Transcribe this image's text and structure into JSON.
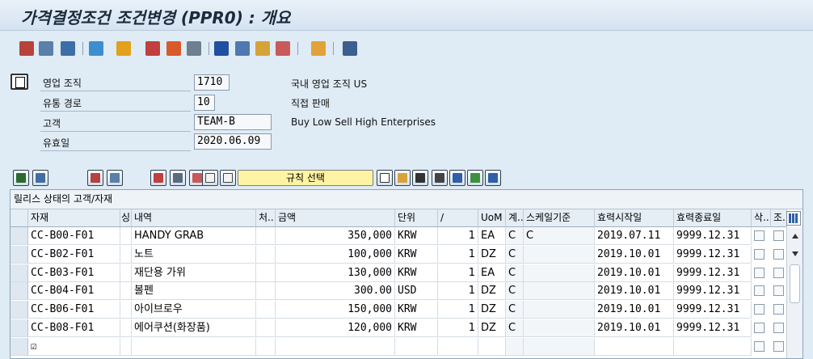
{
  "window": {
    "title": "가격결정조건 조건변경 (PPR0) : 개요"
  },
  "app_toolbar": {
    "icons": [
      "other-condition-type-icon",
      "display-icon",
      "variable-key-icon",
      "copy-icon",
      "execute-icon",
      "validity-periods-icon",
      "free-goods-icon",
      "change-icon",
      "info-icon",
      "details-icon",
      "key-icon",
      "scales-icon",
      "user-icon",
      "extras-icon"
    ]
  },
  "header": {
    "fields": [
      {
        "label": "영업 조직",
        "value": "1710",
        "desc": "국내 영업 조직 US"
      },
      {
        "label": "유통 경로",
        "value": "10",
        "desc": "직접 판매"
      },
      {
        "label": "고객",
        "value": "TEAM-B",
        "desc": "Buy Low Sell High Enterprises"
      },
      {
        "label": "유효일",
        "value": "2020.06.09",
        "desc": ""
      }
    ]
  },
  "grid_toolbar": {
    "rule_button": "규칙 선택"
  },
  "grid": {
    "title": "릴리스 상태의 고객/자재",
    "columns": [
      "자재",
      "싱",
      "내역",
      "처..",
      "금액",
      "단위",
      "/",
      "UoM",
      "계..",
      "스케일기준",
      "효력시작일",
      "효력종료일",
      "삭..",
      "조.."
    ],
    "rows": [
      {
        "material": "CC-B00-F01",
        "desc": "HANDY GRAB",
        "amount": "350,000",
        "unit": "KRW",
        "per": "1",
        "uom": "EA",
        "calc": "C",
        "scale": "C",
        "from": "2019.07.11",
        "to": "9999.12.31"
      },
      {
        "material": "CC-B02-F01",
        "desc": "노트",
        "amount": "100,000",
        "unit": "KRW",
        "per": "1",
        "uom": "DZ",
        "calc": "C",
        "scale": "",
        "from": "2019.10.01",
        "to": "9999.12.31"
      },
      {
        "material": "CC-B03-F01",
        "desc": "재단용 가위",
        "amount": "130,000",
        "unit": "KRW",
        "per": "1",
        "uom": "EA",
        "calc": "C",
        "scale": "",
        "from": "2019.10.01",
        "to": "9999.12.31"
      },
      {
        "material": "CC-B04-F01",
        "desc": "볼펜",
        "amount": "300.00",
        "unit": "USD",
        "per": "1",
        "uom": "DZ",
        "calc": "C",
        "scale": "",
        "from": "2019.10.01",
        "to": "9999.12.31"
      },
      {
        "material": "CC-B06-F01",
        "desc": "아이브로우",
        "amount": "150,000",
        "unit": "KRW",
        "per": "1",
        "uom": "DZ",
        "calc": "C",
        "scale": "",
        "from": "2019.10.01",
        "to": "9999.12.31"
      },
      {
        "material": "CC-B08-F01",
        "desc": "에어쿠션(화장품)",
        "amount": "120,000",
        "unit": "KRW",
        "per": "1",
        "uom": "DZ",
        "calc": "C",
        "scale": "",
        "from": "2019.10.01",
        "to": "9999.12.31"
      }
    ],
    "empty_row_mark": "☑"
  }
}
